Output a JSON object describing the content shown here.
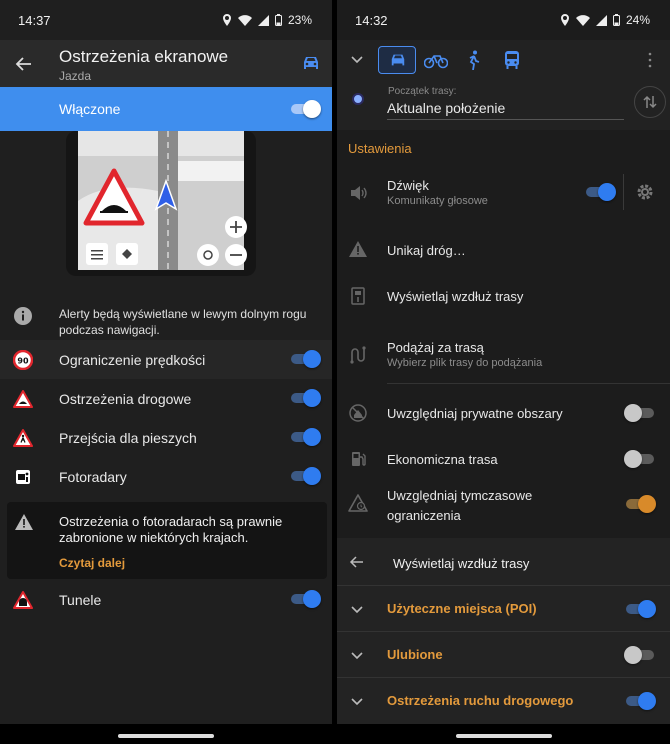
{
  "left": {
    "status": {
      "time": "14:37",
      "battery": "23%"
    },
    "header": {
      "title": "Ostrzeżenia ekranowe",
      "subtitle": "Jazda"
    },
    "enabled": {
      "label": "Włączone",
      "on": true
    },
    "info_text": "Alerty będą wyświetlane w lewym dolnym rogu podczas nawigacji.",
    "alerts": [
      {
        "label": "Ograniczenie prędkości",
        "icon": "speed-limit-90-icon",
        "badge": "90",
        "on": true
      },
      {
        "label": "Ostrzeżenia drogowe",
        "icon": "road-warning-icon",
        "on": true
      },
      {
        "label": "Przejścia dla pieszych",
        "icon": "pedestrian-crossing-icon",
        "on": true
      },
      {
        "label": "Fotoradary",
        "icon": "speed-camera-icon",
        "on": true
      }
    ],
    "warning": {
      "text": "Ostrzeżenia o fotoradarach są prawnie zabronione w niektórych krajach.",
      "link": "Czytaj dalej"
    },
    "tunnels": {
      "label": "Tunele",
      "icon": "tunnel-icon",
      "on": true
    }
  },
  "right": {
    "status": {
      "time": "14:32",
      "battery": "24%"
    },
    "route_start": {
      "label": "Początek trasy:",
      "value": "Aktualne położenie"
    },
    "settings_heading": "Ustawienia",
    "settings": [
      {
        "label": "Dźwięk",
        "sub": "Komunikaty głosowe",
        "icon": "speaker-icon",
        "toggle": "on",
        "gear": true
      },
      {
        "label": "Unikaj dróg…",
        "icon": "warning-icon"
      },
      {
        "label": "Wyświetlaj wzdłuż trasy",
        "icon": "display-along-route-icon"
      },
      {
        "label": "Podążaj za trasą",
        "sub": "Wybierz plik trasy do podążania",
        "icon": "route-file-icon"
      },
      {
        "label": "Uwzględniaj prywatne obszary",
        "icon": "private-area-icon",
        "toggle": "off"
      },
      {
        "label": "Ekonomiczna trasa",
        "icon": "fuel-icon",
        "toggle": "off"
      },
      {
        "label": "Uwzględniaj tymczasowe ograniczenia",
        "icon": "temporary-restriction-icon",
        "toggle": "orange"
      }
    ],
    "display_section": {
      "title": "Wyświetlaj wzdłuż trasy",
      "items": [
        {
          "label": "Użyteczne miejsca (POI)",
          "on": true
        },
        {
          "label": "Ulubione",
          "on": false
        },
        {
          "label": "Ostrzeżenia ruchu drogowego",
          "on": true
        }
      ]
    }
  },
  "colors": {
    "accent_blue": "#3f8eee",
    "accent_orange": "#e39a3c",
    "toggle_blue": "#2f7cf0"
  }
}
